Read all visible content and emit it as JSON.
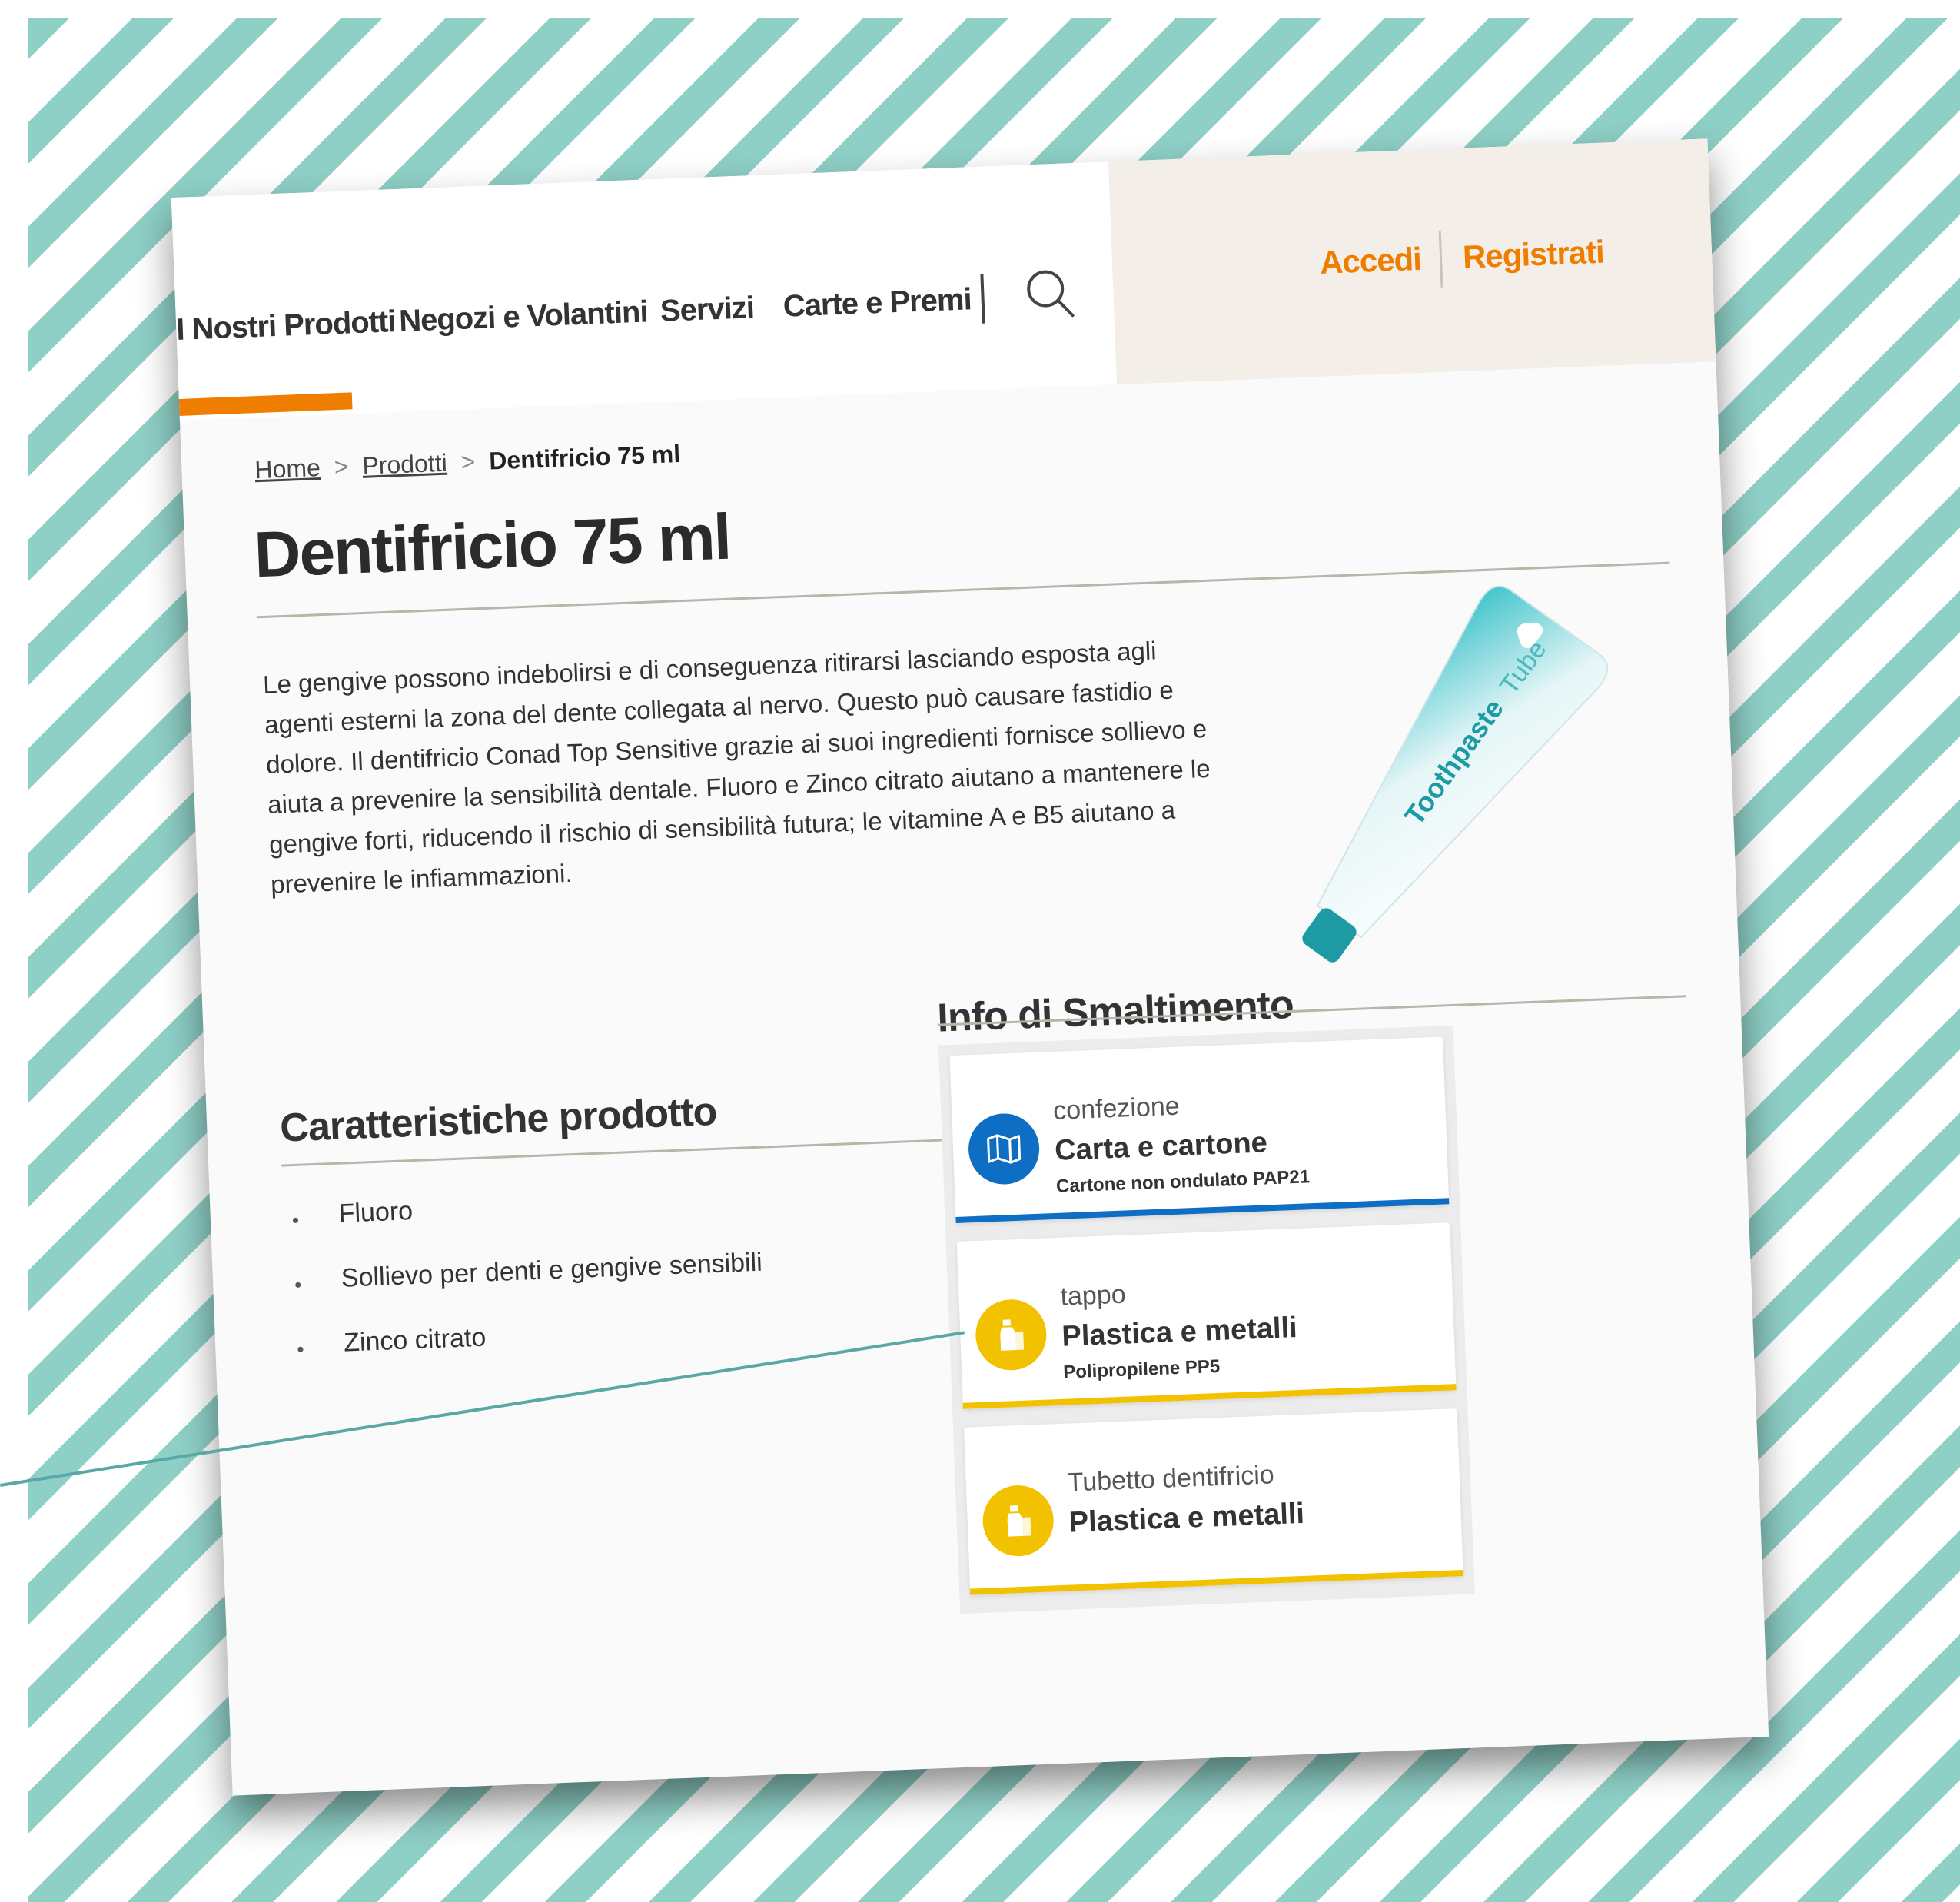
{
  "nav": {
    "items": [
      {
        "label": "I Nostri Prodotti",
        "active": true
      },
      {
        "label": "Negozi e Volantini"
      },
      {
        "label": "Servizi"
      },
      {
        "label": "Carte e Premi"
      }
    ],
    "search_icon": "search-icon",
    "accent": "#ef7d00"
  },
  "auth": {
    "login": "Accedi",
    "register": "Registrati"
  },
  "breadcrumb": {
    "home": "Home",
    "products": "Prodotti",
    "current": "Dentifricio 75 ml"
  },
  "product": {
    "title": "Dentifricio 75 ml",
    "description": "Le gengive possono indebolirsi e di conseguenza ritirarsi lasciando esposta agli agenti esterni la zona del dente collegata al nervo. Questo può causare fastidio e dolore. Il dentifricio Conad Top Sensitive grazie ai suoi ingredienti fornisce sollievo e aiuta a prevenire la sensibilità dentale. Fluoro e Zinco citrato aiutano a mantenere le gengive forti, riducendo il rischio di sensibilità futura; le vitamine A e B5 aiutano a prevenire le infiammazioni.",
    "image_text": {
      "brand": "Toothpaste",
      "suffix": "Tube"
    }
  },
  "features": {
    "title": "Caratteristiche prodotto",
    "items": [
      "Fluoro",
      "Sollievo per denti e gengive sensibili",
      "Zinco citrato"
    ]
  },
  "disposal": {
    "title": "Info di Smaltimento",
    "items": [
      {
        "label": "confezione",
        "material": "Carta e cartone",
        "detail": "Cartone non ondulato PAP21",
        "color": "#0d6ec4",
        "icon": "map-icon"
      },
      {
        "label": "tappo",
        "material": "Plastica e metalli",
        "detail": "Polipropilene PP5",
        "color": "#f2c200",
        "icon": "bottle-icon"
      },
      {
        "label": "Tubetto dentifricio",
        "material": "Plastica e metalli",
        "detail": "",
        "color": "#f2c200",
        "icon": "bottle-icon"
      }
    ]
  }
}
